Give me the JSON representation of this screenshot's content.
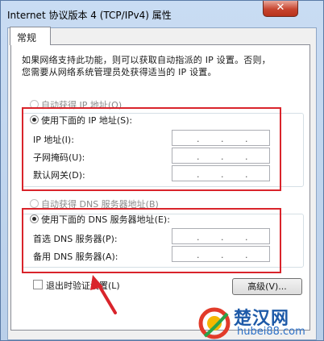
{
  "window": {
    "title": "Internet 协议版本 4 (TCP/IPv4) 属性",
    "close_label": "✕"
  },
  "tabs": [
    {
      "label": "常规"
    }
  ],
  "description": {
    "line1": "如果网络支持此功能，则可以获取自动指派的 IP 设置。否则，",
    "line2": "您需要从网络系统管理员处获得适当的 IP 设置。"
  },
  "ip_section": {
    "auto_label": "自动获得 IP 地址(O)",
    "manual_label": "使用下面的 IP 地址(S):",
    "fields": [
      {
        "label": "IP 地址(I):",
        "value": ""
      },
      {
        "label": "子网掩码(U):",
        "value": ""
      },
      {
        "label": "默认网关(D):",
        "value": ""
      }
    ]
  },
  "dns_section": {
    "auto_label": "自动获得 DNS 服务器地址(B)",
    "manual_label": "使用下面的 DNS 服务器地址(E):",
    "fields": [
      {
        "label": "首选 DNS 服务器(P):",
        "value": ""
      },
      {
        "label": "备用 DNS 服务器(A):",
        "value": ""
      }
    ]
  },
  "validate_label": "退出时验证设置(L)",
  "advanced_label": "高级(V)...",
  "watermark": {
    "name": "楚汉网",
    "url": "hubei88.com"
  },
  "colors": {
    "highlight_red": "#d9242b",
    "watermark_blue": "#1e5aa8"
  }
}
